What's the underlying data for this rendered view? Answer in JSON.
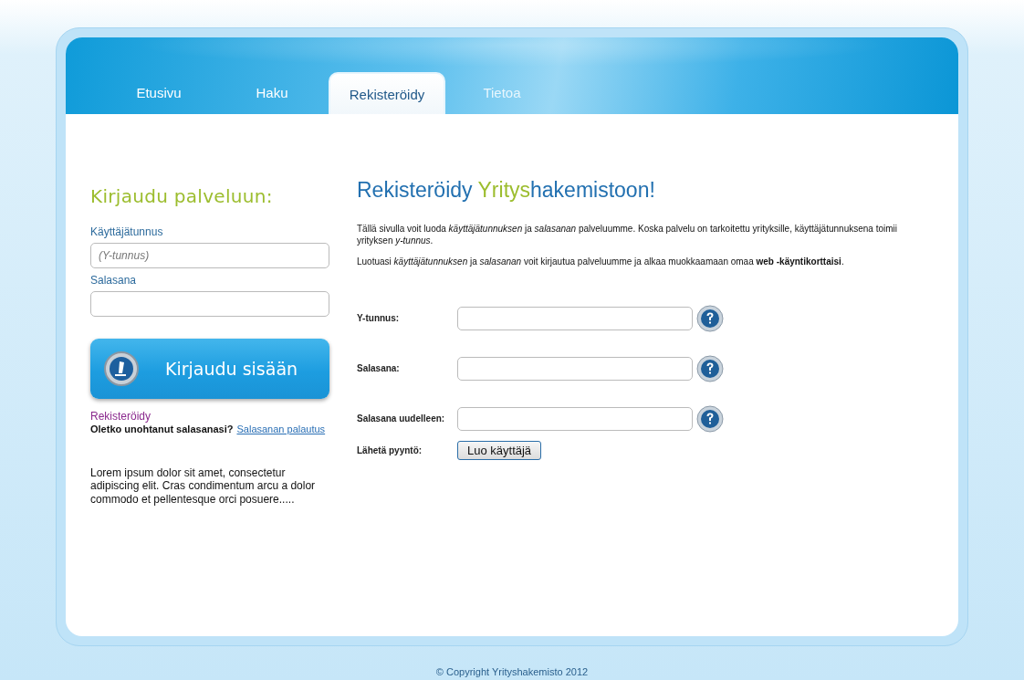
{
  "tabs": [
    {
      "label": "Etusivu",
      "selected": false
    },
    {
      "label": "Haku",
      "selected": false
    },
    {
      "label": "Rekisteröidy",
      "selected": true
    },
    {
      "label": "Tietoa",
      "selected": false
    }
  ],
  "login": {
    "title": "Kirjaudu palveluun:",
    "username_label": "Käyttäjätunnus",
    "username_placeholder": "(Y-tunnus)",
    "password_label": "Salasana",
    "button": "Kirjaudu sisään",
    "register_link": "Rekisteröidy",
    "forgot_text": "Oletko unohtanut salasanasi?",
    "forgot_link": "Salasanan palautus",
    "lorem": "Lorem ipsum dolor sit amet, consectetur adipiscing elit. Cras condimentum arcu a dolor commodo et pellentesque orci posuere....."
  },
  "main": {
    "title_parts": [
      {
        "text": "Rekisteröidy ",
        "highlight": false
      },
      {
        "text": "Yritys",
        "highlight": true
      },
      {
        "text": "hakemistoon!",
        "highlight": false
      }
    ],
    "paragraphs": [
      "Tällä sivulla voit luoda *käyttäjätunnuksen* ja *salasanan* palveluumme. Koska palvelu on tarkoitettu yrityksille, käyttäjätunnuksena toimii yrityksen *y-tunnus*.",
      "Luotuasi *käyttäjätunnuksen* ja *salasanan* voit kirjautua palveluumme ja alkaa muokkaamaan omaa **web -käyntikorttaisi**."
    ],
    "fields": [
      {
        "label": "Y-tunnus:"
      },
      {
        "label": "Salasana:"
      },
      {
        "label": "Salasana uudelleen:"
      }
    ],
    "submit_label": "Lähetä pyyntö:",
    "submit_button": "Luo käyttäjä"
  },
  "footer": "© Copyright Yrityshakemisto 2012"
}
